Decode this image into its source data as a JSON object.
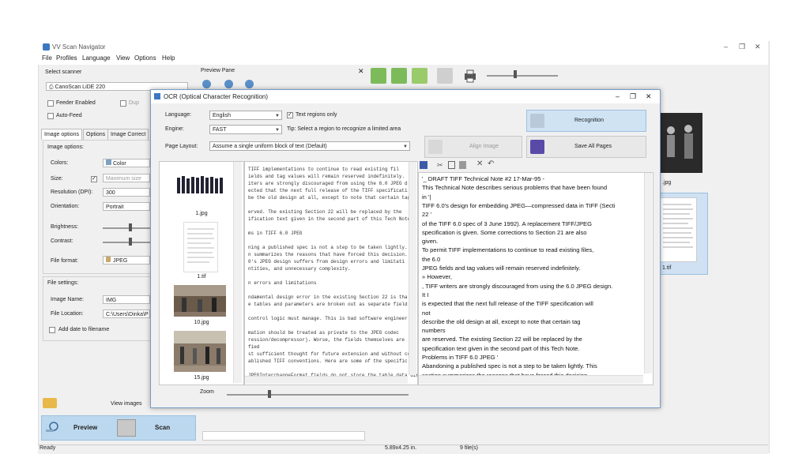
{
  "app": {
    "title": "VV Scan Navigator",
    "menu": [
      "File",
      "Profiles",
      "Language",
      "View",
      "Options",
      "Help"
    ],
    "window_controls": [
      "–",
      "❐",
      "✕"
    ]
  },
  "left": {
    "select_scanner_label": "Select scanner",
    "scanner_value": "CanoScan LiDE 220",
    "feeder_label": "Feeder Enabled",
    "duplex_label": "Dup",
    "autofeed_label": "Auto-Feed",
    "tabs": [
      "Image options",
      "Options",
      "Image Correct"
    ],
    "image_options_label": "Image options:",
    "colors_label": "Colors:",
    "colors_value": "Color",
    "size_label": "Size:",
    "size_value": "Maximum size",
    "resolution_label": "Resolution (DPI):",
    "resolution_value": "300",
    "orientation_label": "Orientation:",
    "orientation_value": "Portrait",
    "brightness_label": "Brightness:",
    "contrast_label": "Contrast:",
    "fileformat_label": "File format:",
    "fileformat_value": "JPEG",
    "file_settings_label": "File settings:",
    "imagename_label": "Image Name:",
    "imagename_value": "IMG",
    "filelocation_label": "File Location:",
    "filelocation_value": "C:\\Users\\Dinka\\P",
    "adddate_label": "Add date to filename",
    "view_images_label": "View images",
    "preview_label": "Preview",
    "scan_label": "Scan"
  },
  "preview_pane": {
    "label": "Preview Pane",
    "close": "✕"
  },
  "right_thumbs": [
    {
      "caption": ".jpg"
    },
    {
      "caption": "1.tif"
    }
  ],
  "status": {
    "left": "Ready",
    "size": "5.89x4.25 in.",
    "files": "9 file(s)"
  },
  "ocr": {
    "title": "OCR (Optical Character Recognition)",
    "language_label": "Language:",
    "language_value": "English",
    "text_regions_label": "Text regions only",
    "engine_label": "Engine:",
    "engine_value": "FAST",
    "tip": "Tip: Select a region to recognize a limited area",
    "page_layout_label": "Page Layout:",
    "page_layout_value": "Assume a single uniform block of text (Default)",
    "recognition_label": "Recognition",
    "align_label": "Align Image",
    "save_all_label": "Save All Pages",
    "zoom_label": "Zoom",
    "images": [
      {
        "caption": "1.jpg"
      },
      {
        "caption": "1.tif"
      },
      {
        "caption": "10.jpg"
      },
      {
        "caption": "15.jpg"
      }
    ],
    "source_lines": [
      "TIFF implementations to continue to read existing fil",
      "ields and tag values will remain reserved indefinitely.",
      "iters are strongly discouraged from using the 6.0 JPEG d",
      "ected that the next full release of the TIFF specificati",
      "be the old design at all, except to note that certain tag",
      "",
      "erved. The existing Section 22 will be replaced by the",
      "ification text given in the second part of this Tech Note.",
      "",
      "ms in TIFF 6.0 JPEG",
      "",
      "ning a published spec is not a step to be taken lightly.",
      "n summarizes the reasons that have forced this decision.",
      "0's JPEG design suffers from design errors and limitati",
      "ntities, and unnecessary complexity.",
      "",
      "n errors and limitations",
      "",
      "ndamental design error in the existing Section 22 is tha",
      "e tables and parameters are broken out as separate field",
      "",
      "control logic must manage. This is bad software engineer",
      "",
      "mation should be treated as private to the JPEG codec",
      "ression/decompressor). Worse, the fields themselves are",
      "fied",
      "st sufficient thought for future extension and without co",
      "ablished TIFF conventions. Here are some of the specific",
      "",
      "JPEGInterchangeFormat fields do not store the table data directly"
    ],
    "text_lines": [
      "'_ DRAFT TIFF Technical Note #2 17-Mar-95 -",
      "This Technical Note describes serious problems that have been found",
      "in '|",
      "TIFF 6.0's design for embedding JPEG—compressed data in TIFF (Secti",
      "22 '",
      "of the TIFF 6.0 spec of 3 June 1992). A replacement TIFF/JPEG",
      "specification is given. Some corrections to Section 21 are also",
      "given.",
      "To permit TIFF implementations to continue to read existing files,",
      "the 6.0",
      "JPEG fields and tag values will remain reserved indefinitely.",
      "» However,",
      ", TIFF writers are strongly discouraged from using the 6.0 JPEG design.",
      "It I",
      "is expected that the next full release of the TIFF specification will",
      "not",
      "describe the old design at all, except to note that certain tag",
      "numbers",
      "are reserved. The existing Section 22 will be replaced by the",
      "specification text given in the second part of this Tech Note.",
      "Problems in TIFF 6.0 JPEG '",
      "Abandoning a published spec is not a step to be taken lightly. This",
      "section summarizes the reasons that have forced this decision."
    ]
  }
}
